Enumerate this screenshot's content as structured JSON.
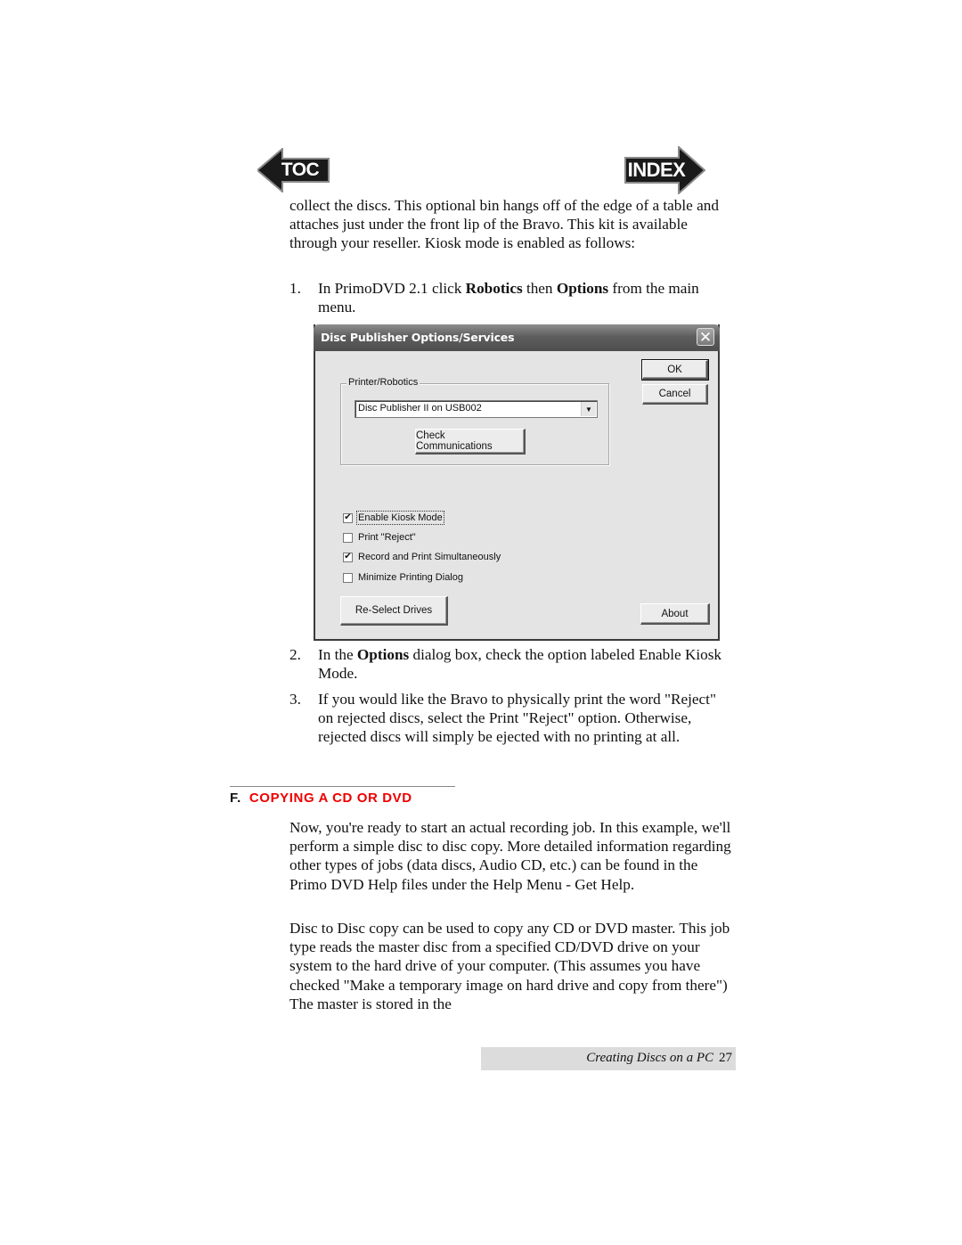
{
  "nav": {
    "toc_label": "TOC",
    "index_label": "INDEX"
  },
  "intro_paragraph": "collect the discs.  This optional bin hangs off of the edge of a table and attaches just under the front lip of the Bravo.  This kit is available through your reseller.  Kiosk mode is enabled as follows:",
  "steps": [
    {
      "number": "1.",
      "parts": [
        "In PrimoDVD 2.1 click ",
        "Robotics",
        " then ",
        "Options",
        " from the main menu."
      ]
    },
    {
      "number": "2.",
      "parts": [
        "In the ",
        "Options",
        " dialog box, check the option labeled Enable Kiosk Mode."
      ]
    },
    {
      "number": "3.",
      "text": "If you would like the Bravo to physically print the word \"Reject\" on rejected discs, select the Print \"Reject\" option. Otherwise, rejected discs will simply be ejected with no printing at all."
    }
  ],
  "dialog": {
    "title": "Disc Publisher Options/Services",
    "close_glyph": "✕",
    "ok_label": "OK",
    "cancel_label": "Cancel",
    "group_label": "Printer/Robotics",
    "printer_select_value": "Disc Publisher II on USB002",
    "dropdown_glyph": "▼",
    "check_comm_label": "Check Communications",
    "checkboxes": [
      {
        "label": "Enable Kiosk Mode",
        "checked": true
      },
      {
        "label": "Print \"Reject\"",
        "checked": false
      },
      {
        "label": "Record and Print Simultaneously",
        "checked": true
      },
      {
        "label": "Minimize Printing Dialog",
        "checked": false
      }
    ],
    "check_glyph": "✔",
    "reselect_label": "Re-Select Drives",
    "about_label": "About"
  },
  "section": {
    "letter": "F.",
    "title": "COPYING A CD OR DVD"
  },
  "section_paragraphs": [
    "Now, you're ready to start an actual recording job. In this example, we'll perform a simple disc to disc copy. More detailed information regarding other types of jobs (data discs, Audio CD, etc.) can be found in the Primo DVD Help files under the Help Menu - Get Help.",
    "Disc to Disc copy can be used to copy any CD or DVD master. This job type reads the master disc from a specified CD/DVD drive on your system to the hard drive of your computer. (This assumes you have checked \"Make a temporary image on hard drive and copy from there\") The master is stored in the"
  ],
  "footer": {
    "title": "Creating Discs on a PC",
    "page_number": "27"
  }
}
